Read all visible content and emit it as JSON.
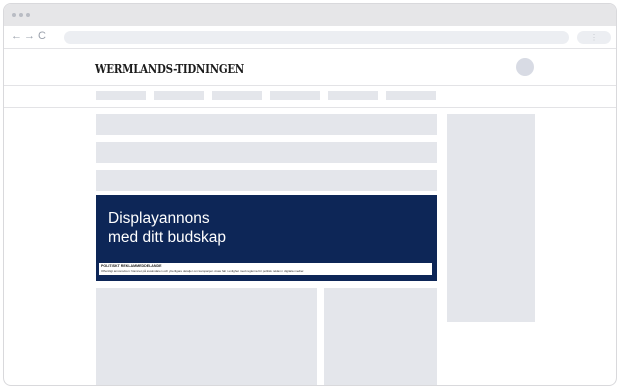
{
  "browser": {
    "back_glyph": "←",
    "forward_glyph": "→",
    "reload_glyph": "C",
    "menu_glyph": "⋮"
  },
  "site": {
    "logo_text": "WERMLANDS-TIDNINGEN"
  },
  "ad": {
    "headline_line1": "Displayannons",
    "headline_line2": "med ditt budskap",
    "disclosure_title": "POLITISKT REKLAMMEDDELANDE",
    "disclosure_text": "Offentligt annonsören: Namnet på avsändaren och ytterligare detaljer om kampanjen visas här i enlighet med reglerna för politisk reklam i digitala medier.",
    "background_color": "#0d2657"
  }
}
